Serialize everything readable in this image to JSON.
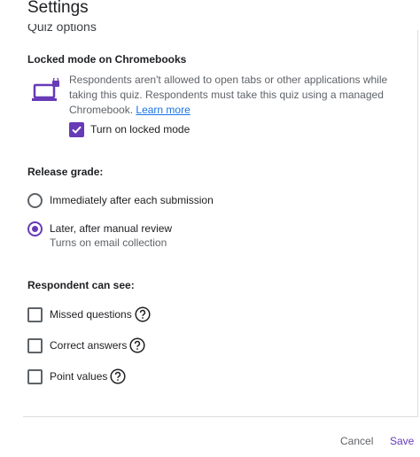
{
  "dialog": {
    "title": "Settings"
  },
  "section_heading": "Quiz options",
  "locked_mode": {
    "heading": "Locked mode on Chromebooks",
    "description": "Respondents aren't allowed to open tabs or other applications while taking this quiz. Respondents must take this quiz using a managed Chromebook.",
    "learn_more": "Learn more",
    "toggle_label": "Turn on locked mode",
    "toggle_checked": true,
    "icon": "laptop-lock-icon"
  },
  "release_grade": {
    "heading": "Release grade:",
    "options": [
      {
        "label": "Immediately after each submission",
        "selected": false
      },
      {
        "label": "Later, after manual review",
        "sublabel": "Turns on email collection",
        "selected": true
      }
    ]
  },
  "respondent_can_see": {
    "heading": "Respondent can see:",
    "options": [
      {
        "label": "Missed questions",
        "checked": false,
        "icon": "help-icon"
      },
      {
        "label": "Correct answers",
        "checked": false,
        "icon": "help-icon"
      },
      {
        "label": "Point values",
        "checked": false,
        "icon": "help-icon"
      }
    ]
  },
  "footer": {
    "cancel_label": "Cancel",
    "save_label": "Save"
  },
  "colors": {
    "accent": "#673ab7",
    "link": "#1a73e8",
    "text": "#202124",
    "secondary": "#5f6368"
  }
}
